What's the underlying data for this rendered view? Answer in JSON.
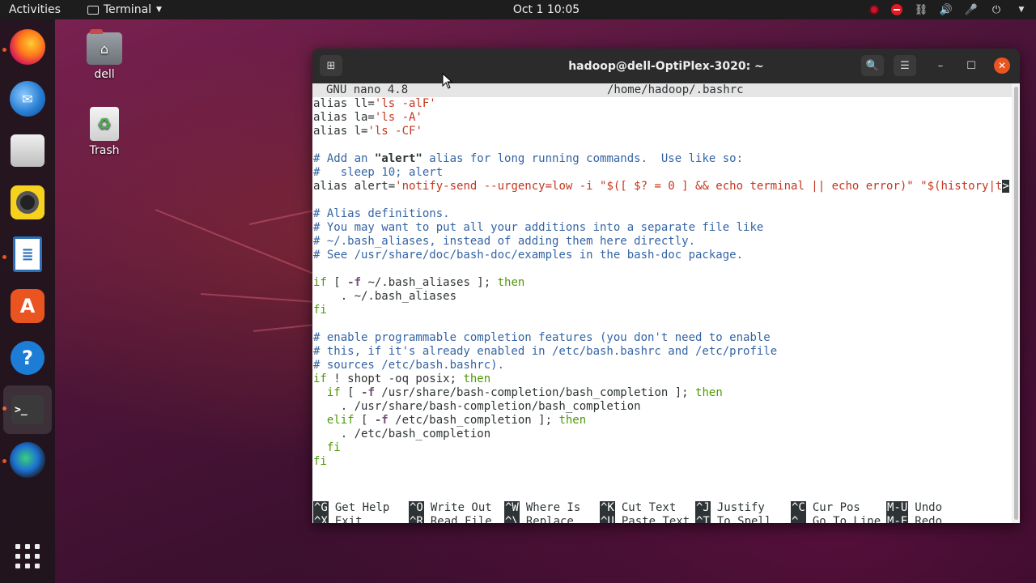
{
  "topbar": {
    "activities": "Activities",
    "app_menu": "Terminal",
    "clock": "Oct 1  10:05"
  },
  "dock": {
    "items": [
      {
        "name": "Firefox",
        "icon": "firefox-icon"
      },
      {
        "name": "Thunderbird",
        "icon": "thunderbird-icon"
      },
      {
        "name": "Files",
        "icon": "files-icon"
      },
      {
        "name": "Rhythmbox",
        "icon": "rhythmbox-icon"
      },
      {
        "name": "LibreOffice Writer",
        "icon": "writer-icon"
      },
      {
        "name": "Ubuntu Software",
        "icon": "software-icon"
      },
      {
        "name": "Help",
        "icon": "help-icon"
      },
      {
        "name": "Terminal",
        "icon": "terminal-icon"
      },
      {
        "name": "Browser",
        "icon": "globe-icon"
      }
    ]
  },
  "desktop": {
    "home_label": "dell",
    "trash_label": "Trash"
  },
  "window": {
    "title": "hadoop@dell-OptiPlex-3020: ~"
  },
  "nano": {
    "version": "GNU nano 4.8",
    "filename": "/home/hadoop/.bashrc",
    "help": [
      [
        {
          "key": "^G",
          "label": "Get Help"
        },
        {
          "key": "^O",
          "label": "Write Out"
        },
        {
          "key": "^W",
          "label": "Where Is"
        },
        {
          "key": "^K",
          "label": "Cut Text"
        },
        {
          "key": "^J",
          "label": "Justify"
        },
        {
          "key": "^C",
          "label": "Cur Pos"
        },
        {
          "key": "M-U",
          "label": "Undo"
        }
      ],
      [
        {
          "key": "^X",
          "label": "Exit"
        },
        {
          "key": "^R",
          "label": "Read File"
        },
        {
          "key": "^\\",
          "label": "Replace"
        },
        {
          "key": "^U",
          "label": "Paste Text"
        },
        {
          "key": "^T",
          "label": "To Spell"
        },
        {
          "key": "^_",
          "label": "Go To Line"
        },
        {
          "key": "M-E",
          "label": "Redo"
        }
      ]
    ]
  },
  "lines": [
    [
      [
        "kw",
        "alias ll="
      ],
      [
        "str",
        "'ls -alF'"
      ]
    ],
    [
      [
        "kw",
        "alias la="
      ],
      [
        "str",
        "'ls -A'"
      ]
    ],
    [
      [
        "kw",
        "alias l="
      ],
      [
        "str",
        "'ls -CF'"
      ]
    ],
    [],
    [
      [
        "cmt",
        "# Add an "
      ],
      [
        "bold",
        "\"alert\""
      ],
      [
        "cmt",
        " alias for long running commands.  Use like so:"
      ]
    ],
    [
      [
        "cmt",
        "#   sleep 10; alert"
      ]
    ],
    [
      [
        "kw",
        "alias alert="
      ],
      [
        "str",
        "'notify-send --urgency=low -i \"$([ $? = 0 ] && echo terminal || echo error)\" \"$(history|t"
      ],
      [
        "ovf",
        ">"
      ]
    ],
    [],
    [
      [
        "cmt",
        "# Alias definitions."
      ]
    ],
    [
      [
        "cmt",
        "# You may want to put all your additions into a separate file like"
      ]
    ],
    [
      [
        "cmt",
        "# ~/.bash_aliases, instead of adding them here directly."
      ]
    ],
    [
      [
        "cmt",
        "# See /usr/share/doc/bash-doc/examples in the bash-doc package."
      ]
    ],
    [],
    [
      [
        "grn",
        "if"
      ],
      [
        "kw",
        " [ "
      ],
      [
        "pur",
        "-f"
      ],
      [
        "kw",
        " ~/.bash_aliases ]; "
      ],
      [
        "grn",
        "then"
      ]
    ],
    [
      [
        "kw",
        "    . ~/.bash_aliases"
      ]
    ],
    [
      [
        "grn",
        "fi"
      ]
    ],
    [],
    [
      [
        "cmt",
        "# enable programmable completion features (you don't need to enable"
      ]
    ],
    [
      [
        "cmt",
        "# this, if it's already enabled in /etc/bash.bashrc and /etc/profile"
      ]
    ],
    [
      [
        "cmt",
        "# sources /etc/bash.bashrc)."
      ]
    ],
    [
      [
        "grn",
        "if"
      ],
      [
        "kw",
        " ! shopt -oq posix; "
      ],
      [
        "grn",
        "then"
      ]
    ],
    [
      [
        "kw",
        "  "
      ],
      [
        "grn",
        "if"
      ],
      [
        "kw",
        " [ "
      ],
      [
        "pur",
        "-f"
      ],
      [
        "kw",
        " /usr/share/bash-completion/bash_completion ]; "
      ],
      [
        "grn",
        "then"
      ]
    ],
    [
      [
        "kw",
        "    . /usr/share/bash-completion/bash_completion"
      ]
    ],
    [
      [
        "kw",
        "  "
      ],
      [
        "grn",
        "elif"
      ],
      [
        "kw",
        " [ "
      ],
      [
        "pur",
        "-f"
      ],
      [
        "kw",
        " /etc/bash_completion ]; "
      ],
      [
        "grn",
        "then"
      ]
    ],
    [
      [
        "kw",
        "    . /etc/bash_completion"
      ]
    ],
    [
      [
        "kw",
        "  "
      ],
      [
        "grn",
        "fi"
      ]
    ],
    [
      [
        "grn",
        "fi"
      ]
    ]
  ]
}
